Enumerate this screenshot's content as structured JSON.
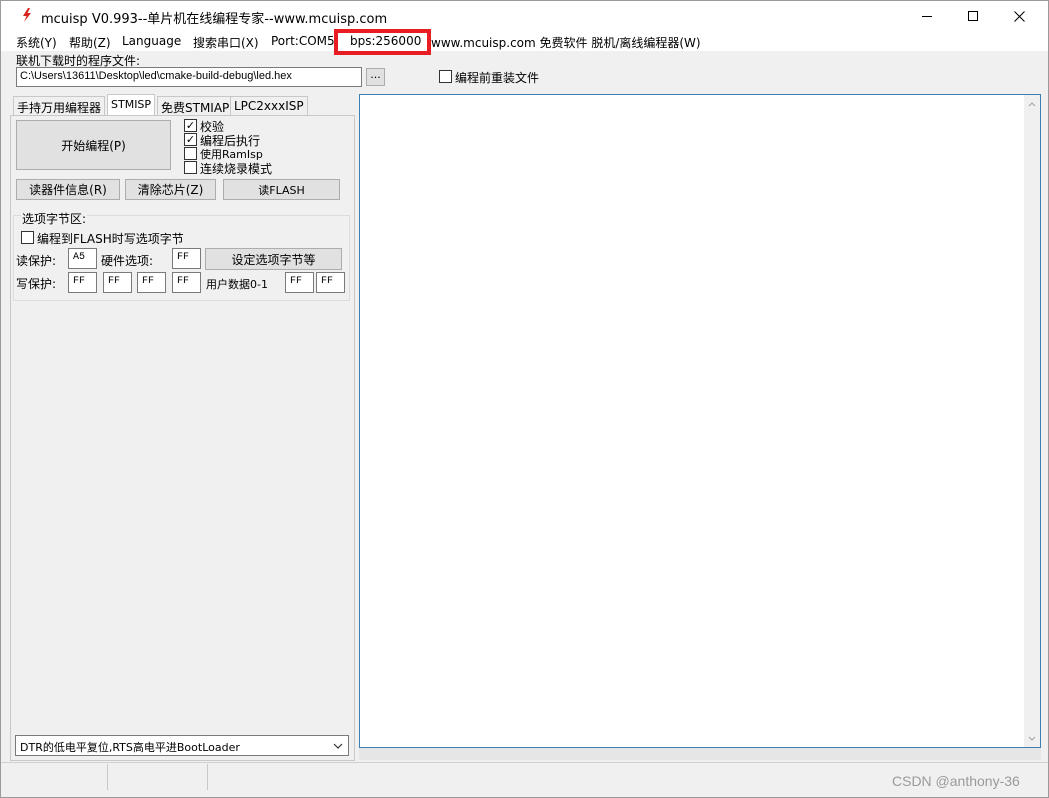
{
  "window": {
    "title": "mcuisp V0.993--单片机在线编程专家--www.mcuisp.com",
    "edge_glyph": "n"
  },
  "menu": {
    "system": "系统(Y)",
    "help": "帮助(Z)",
    "language": "Language",
    "search_port": "搜索串口(X)",
    "port": "Port:COM5",
    "bps": "bps:256000",
    "website": "www.mcuisp.com 免费软件 脱机/离线编程器(W)"
  },
  "file": {
    "label": "联机下载时的程序文件:",
    "path": "C:\\Users\\13611\\Desktop\\led\\cmake-build-debug\\led.hex",
    "browse_label": "...",
    "reload_label": "编程前重装文件",
    "reload_checked": false
  },
  "tabs": [
    {
      "label": "手持万用编程器",
      "active": false
    },
    {
      "label": "STMISP",
      "active": true
    },
    {
      "label": "免费STMIAP",
      "active": false
    },
    {
      "label": "LPC2xxxISP",
      "active": false
    }
  ],
  "stmisp": {
    "start_button": "开始编程(P)",
    "options": [
      {
        "label": "校验",
        "checked": true
      },
      {
        "label": "编程后执行",
        "checked": true
      },
      {
        "label": "使用RamIsp",
        "checked": false
      },
      {
        "label": "连续烧录模式",
        "checked": false
      }
    ],
    "read_info_button": "读器件信息(R)",
    "erase_button": "清除芯片(Z)",
    "read_flash_button": "读FLASH",
    "option_bytes": {
      "group_title": "选项字节区:",
      "write_on_program_label": "编程到FLASH时写选项字节",
      "write_on_program_checked": false,
      "read_protect_label": "读保护:",
      "read_protect_value": "A5",
      "hw_option_label": "硬件选项:",
      "hw_option_value": "FF",
      "set_button": "设定选项字节等",
      "write_protect_label": "写保护:",
      "write_protect_values": [
        "FF",
        "FF",
        "FF",
        "FF"
      ],
      "user_data_label": "用户数据0-1",
      "user_data_values": [
        "FF",
        "FF"
      ]
    },
    "boot_mode": "DTR的低电平复位,RTS高电平进BootLoader"
  },
  "status": {
    "watermark": "CSDN @anthony-36"
  },
  "colors": {
    "highlight": "#e81c23",
    "log_border": "#3c7fb1"
  }
}
